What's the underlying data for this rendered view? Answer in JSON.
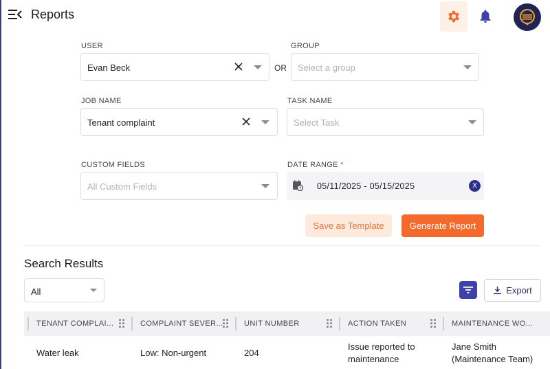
{
  "header": {
    "title": "Reports"
  },
  "form": {
    "user": {
      "label": "USER",
      "value": "Evan Beck"
    },
    "or_label": "OR",
    "group": {
      "label": "GROUP",
      "placeholder": "Select a group"
    },
    "job_name": {
      "label": "JOB NAME",
      "value": "Tenant complaint"
    },
    "task_name": {
      "label": "TASK NAME",
      "placeholder": "Select Task"
    },
    "custom_fields": {
      "label": "CUSTOM FIELDS",
      "placeholder": "All Custom Fields"
    },
    "date_range": {
      "label": "DATE RANGE",
      "required_mark": "*",
      "value": "05/11/2025 - 05/15/2025",
      "clear_label": "X"
    },
    "save_template_label": "Save as Template",
    "generate_label": "Generate Report"
  },
  "results": {
    "title": "Search Results",
    "filter_value": "All",
    "export_label": "Export",
    "columns": [
      "TENANT COMPLAI...",
      "COMPLAINT SEVER...",
      "UNIT NUMBER",
      "ACTION TAKEN",
      "MAINTENANCE WO..."
    ],
    "rows": [
      {
        "tenant_complaint": "Water leak",
        "complaint_severity": "Low: Non-urgent",
        "unit_number": "204",
        "action_taken_1": "Issue reported to",
        "action_taken_2": "maintenance",
        "maintenance_1": "Jane Smith",
        "maintenance_2": "(Maintenance Team)"
      }
    ]
  },
  "colors": {
    "accent_orange": "#f46a2c",
    "accent_navy": "#2c318a",
    "template_bg": "#fdeadc"
  },
  "icons": [
    "menu-collapse-icon",
    "gear-icon",
    "bell-icon",
    "avatar-logo-icon",
    "close-icon",
    "chevron-down-icon",
    "calendar-clock-icon",
    "filter-icon",
    "download-icon",
    "drag-handle-icon"
  ]
}
